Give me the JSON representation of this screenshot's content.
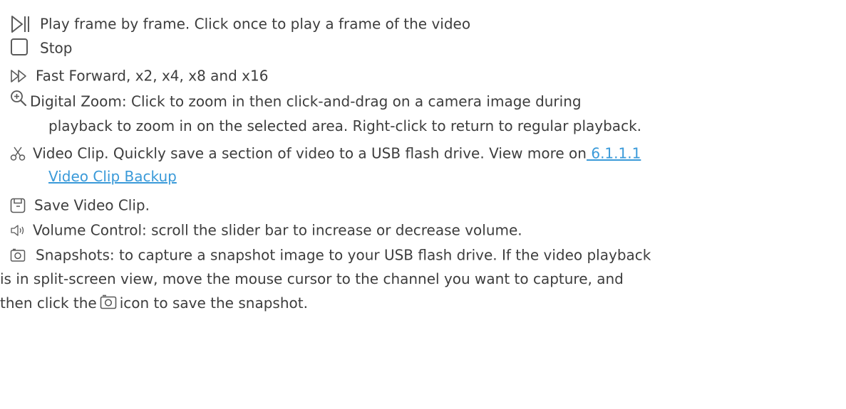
{
  "items": [
    {
      "icon": "step-frame-icon",
      "text": "Play frame by frame. Click once to play a frame of the video"
    },
    {
      "icon": "stop-icon",
      "text": "Stop"
    },
    {
      "icon": "fast-forward-icon",
      "text": "Fast Forward, x2, x4, x8 and x16"
    },
    {
      "icon": "zoom-in-icon",
      "text": "Digital Zoom: Click to zoom in then click-and-drag on a camera image during",
      "text2": "playback to zoom in on the selected area. Right-click to return to regular playback."
    },
    {
      "icon": "scissors-icon",
      "text": "Video Clip. Quickly save a section of video to a USB flash drive. View more on",
      "link1": " 6.1.1.1",
      "link2": "Video Clip Backup"
    },
    {
      "icon": "save-icon",
      "text": "Save Video Clip."
    },
    {
      "icon": "volume-icon",
      "text": "Volume Control: scroll the slider bar to increase or decrease volume."
    },
    {
      "icon": "camera-icon",
      "text": "Snapshots: to capture a snapshot image to your USB flash drive. If the video playback",
      "text2": "is in split-screen view, move the mouse cursor to the channel you want to capture, and",
      "text3a": "then click the",
      "text3b": "icon to save the snapshot."
    }
  ],
  "colors": {
    "text": "#3d3d3d",
    "link": "#3a9ad9",
    "icon": "#5a5a5a"
  }
}
